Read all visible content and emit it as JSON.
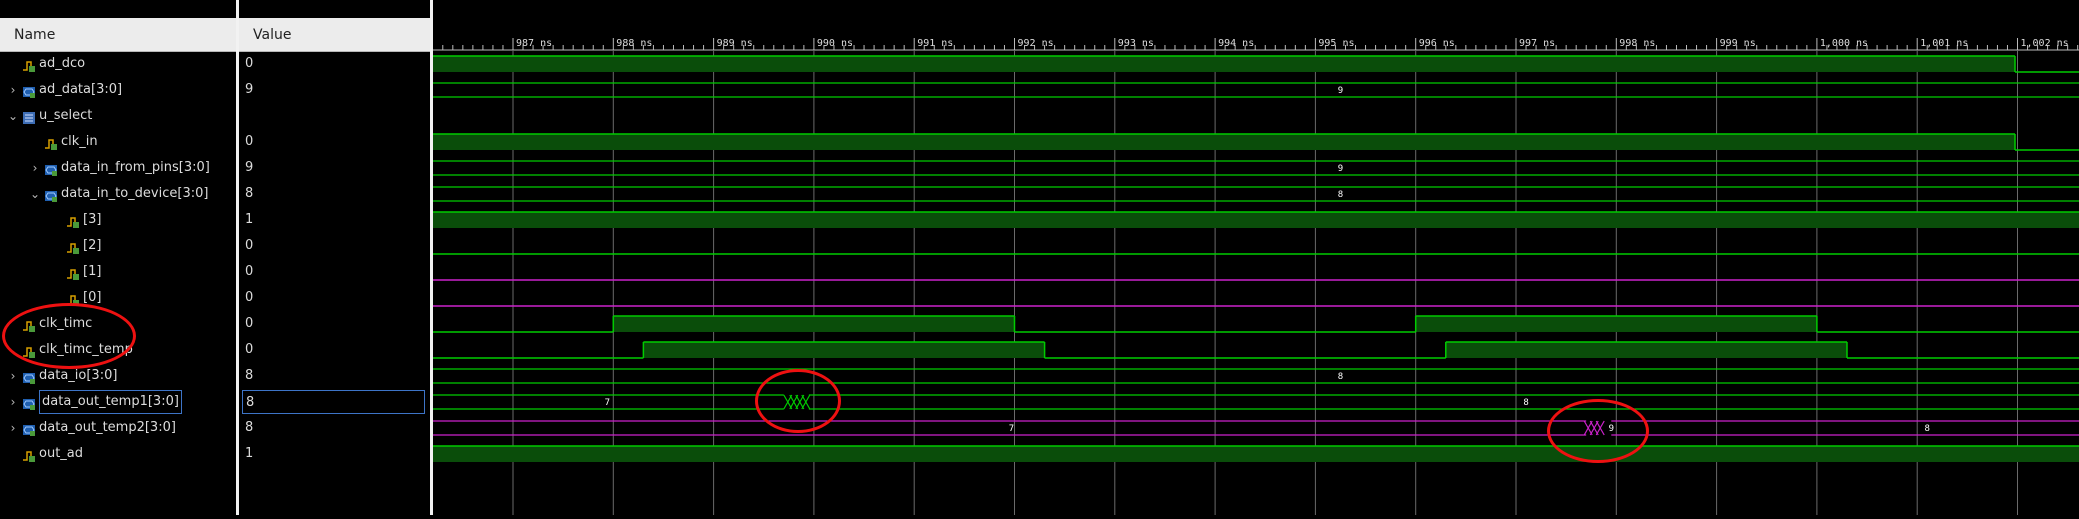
{
  "name_header": "Name",
  "value_header": "Value",
  "signals": [
    {
      "name": "ad_dco",
      "value": "0",
      "type": "bit",
      "indent": 0,
      "expand": ""
    },
    {
      "name": "ad_data[3:0]",
      "value": "9",
      "type": "bus",
      "indent": 0,
      "expand": "›"
    },
    {
      "name": "u_select",
      "value": "",
      "type": "scope",
      "indent": 0,
      "expand": "⌄"
    },
    {
      "name": "clk_in",
      "value": "0",
      "type": "bit",
      "indent": 1,
      "expand": ""
    },
    {
      "name": "data_in_from_pins[3:0]",
      "value": "9",
      "type": "bus",
      "indent": 1,
      "expand": "›"
    },
    {
      "name": "data_in_to_device[3:0]",
      "value": "8",
      "type": "bus",
      "indent": 1,
      "expand": "⌄"
    },
    {
      "name": "[3]",
      "value": "1",
      "type": "bit",
      "indent": 2,
      "expand": ""
    },
    {
      "name": "[2]",
      "value": "0",
      "type": "bit",
      "indent": 2,
      "expand": ""
    },
    {
      "name": "[1]",
      "value": "0",
      "type": "bit",
      "indent": 2,
      "expand": ""
    },
    {
      "name": "[0]",
      "value": "0",
      "type": "bit",
      "indent": 2,
      "expand": ""
    },
    {
      "name": "clk_timc",
      "value": "0",
      "type": "bit",
      "indent": 0,
      "expand": ""
    },
    {
      "name": "clk_timc_temp",
      "value": "0",
      "type": "bit",
      "indent": 0,
      "expand": ""
    },
    {
      "name": "data_io[3:0]",
      "value": "8",
      "type": "bus",
      "indent": 0,
      "expand": "›"
    },
    {
      "name": "data_out_temp1[3:0]",
      "value": "8",
      "type": "bus",
      "indent": 0,
      "expand": "›",
      "selected": true
    },
    {
      "name": "data_out_temp2[3:0]",
      "value": "8",
      "type": "bus",
      "indent": 0,
      "expand": "›"
    },
    {
      "name": "out_ad",
      "value": "1",
      "type": "bit",
      "indent": 0,
      "expand": ""
    }
  ],
  "time_ticks": [
    "987 ns",
    "988 ns",
    "989 ns",
    "990 ns",
    "991 ns",
    "992 ns",
    "993 ns",
    "994 ns",
    "995 ns",
    "996 ns",
    "997 ns",
    "998 ns",
    "999 ns",
    "1,000 ns",
    "1,001 ns",
    "1,002 ns"
  ],
  "bus_labels": {
    "ad_data": [
      "9"
    ],
    "data_in_from_pins": [
      "9"
    ],
    "data_in_to_device": [
      "8"
    ],
    "data_io": [
      "8"
    ],
    "data_out_temp1": [
      "7",
      "8"
    ],
    "data_out_temp2": [
      "7",
      "9",
      "8"
    ]
  },
  "colors": {
    "wave_green": "#00cc00",
    "wave_fill": "#0a4d0a",
    "wave_magenta": "#cc22cc",
    "grid": "#6a6a6a",
    "annotation": "#e11111"
  }
}
